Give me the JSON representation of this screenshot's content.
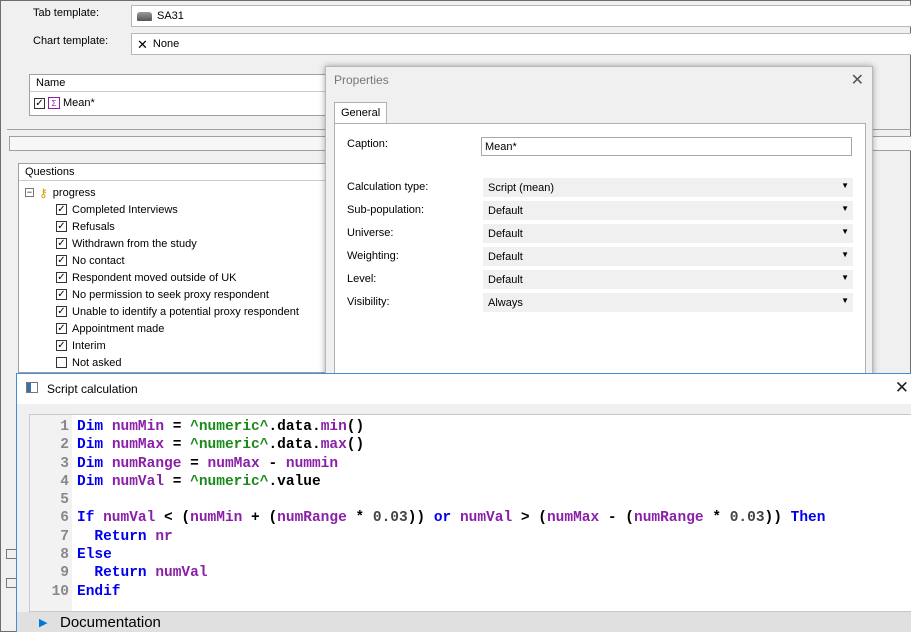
{
  "top": {
    "tab_template_label": "Tab template:",
    "tab_template_value": "SA31",
    "chart_template_label": "Chart template:",
    "chart_template_value": "None"
  },
  "name_list": {
    "header": "Name",
    "items": [
      {
        "label": "Mean*",
        "checked": true
      }
    ]
  },
  "questions": {
    "header": "Questions",
    "group": "progress",
    "items": [
      {
        "label": "Completed Interviews",
        "checked": true
      },
      {
        "label": "Refusals",
        "checked": true
      },
      {
        "label": "Withdrawn from the study",
        "checked": true
      },
      {
        "label": "No contact",
        "checked": true
      },
      {
        "label": "Respondent moved outside of UK",
        "checked": true
      },
      {
        "label": "No permission to seek proxy respondent",
        "checked": true
      },
      {
        "label": "Unable to identify a potential proxy respondent",
        "checked": true
      },
      {
        "label": "Appointment made",
        "checked": true
      },
      {
        "label": "Interim",
        "checked": true
      },
      {
        "label": "Not asked",
        "checked": false
      }
    ]
  },
  "properties": {
    "title": "Properties",
    "tab": "General",
    "caption_label": "Caption:",
    "caption_value": "Mean*",
    "rows": [
      {
        "label": "Calculation type:",
        "value": "Script (mean)"
      },
      {
        "label": "Sub-population:",
        "value": "Default"
      },
      {
        "label": "Universe:",
        "value": "Default"
      },
      {
        "label": "Weighting:",
        "value": "Default"
      },
      {
        "label": "Level:",
        "value": "Default"
      },
      {
        "label": "Visibility:",
        "value": "Always"
      }
    ]
  },
  "script": {
    "title": "Script calculation",
    "line_numbers": [
      "1",
      "2",
      "3",
      "4",
      "5",
      "6",
      "7",
      "8",
      "9",
      "10"
    ],
    "tokens": [
      {
        "kw": "Dim "
      },
      {
        "var": "numMin"
      },
      {
        "op": " = "
      },
      {
        "str": "^numeric^"
      },
      {
        "op": ".data."
      },
      {
        "var": "min"
      },
      {
        "op": "()"
      },
      {
        "nl": 1
      },
      {
        "kw": "Dim "
      },
      {
        "var": "numMax"
      },
      {
        "op": " = "
      },
      {
        "str": "^numeric^"
      },
      {
        "op": ".data."
      },
      {
        "var": "max"
      },
      {
        "op": "()"
      },
      {
        "nl": 1
      },
      {
        "kw": "Dim "
      },
      {
        "var": "numRange"
      },
      {
        "op": " = "
      },
      {
        "var": "numMax"
      },
      {
        "op": " - "
      },
      {
        "var": "nummin"
      },
      {
        "nl": 1
      },
      {
        "kw": "Dim "
      },
      {
        "var": "numVal"
      },
      {
        "op": " = "
      },
      {
        "str": "^numeric^"
      },
      {
        "op": ".value"
      },
      {
        "nl": 1
      },
      {
        "nl": 1
      },
      {
        "kw": "If "
      },
      {
        "var": "numVal"
      },
      {
        "op": " < ("
      },
      {
        "var": "numMin"
      },
      {
        "op": " + ("
      },
      {
        "var": "numRange"
      },
      {
        "op": " * "
      },
      {
        "num": "0.03"
      },
      {
        "op": ")) "
      },
      {
        "kw": "or "
      },
      {
        "var": "numVal"
      },
      {
        "op": " > ("
      },
      {
        "var": "numMax"
      },
      {
        "op": " - ("
      },
      {
        "var": "numRange"
      },
      {
        "op": " * "
      },
      {
        "num": "0.03"
      },
      {
        "op": ")) "
      },
      {
        "kw": "Then"
      },
      {
        "nl": 1
      },
      {
        "op": "  "
      },
      {
        "kw": "Return "
      },
      {
        "var": "nr"
      },
      {
        "nl": 1
      },
      {
        "kw": "Else"
      },
      {
        "nl": 1
      },
      {
        "op": "  "
      },
      {
        "kw": "Return "
      },
      {
        "var": "numVal"
      },
      {
        "nl": 1
      },
      {
        "kw": "Endif"
      }
    ],
    "documentation_label": "Documentation"
  },
  "colors": {
    "keyword": "#0000ee",
    "variable": "#8a1fa8",
    "string": "#1a8a1a",
    "accent": "#0078d7"
  },
  "icons": [
    "disk-icon",
    "x-chart-icon",
    "checkbox-icon",
    "calc-icon",
    "key-icon",
    "close-icon",
    "window-icon",
    "expand-arrow-icon",
    "dropdown-arrow-icon"
  ]
}
